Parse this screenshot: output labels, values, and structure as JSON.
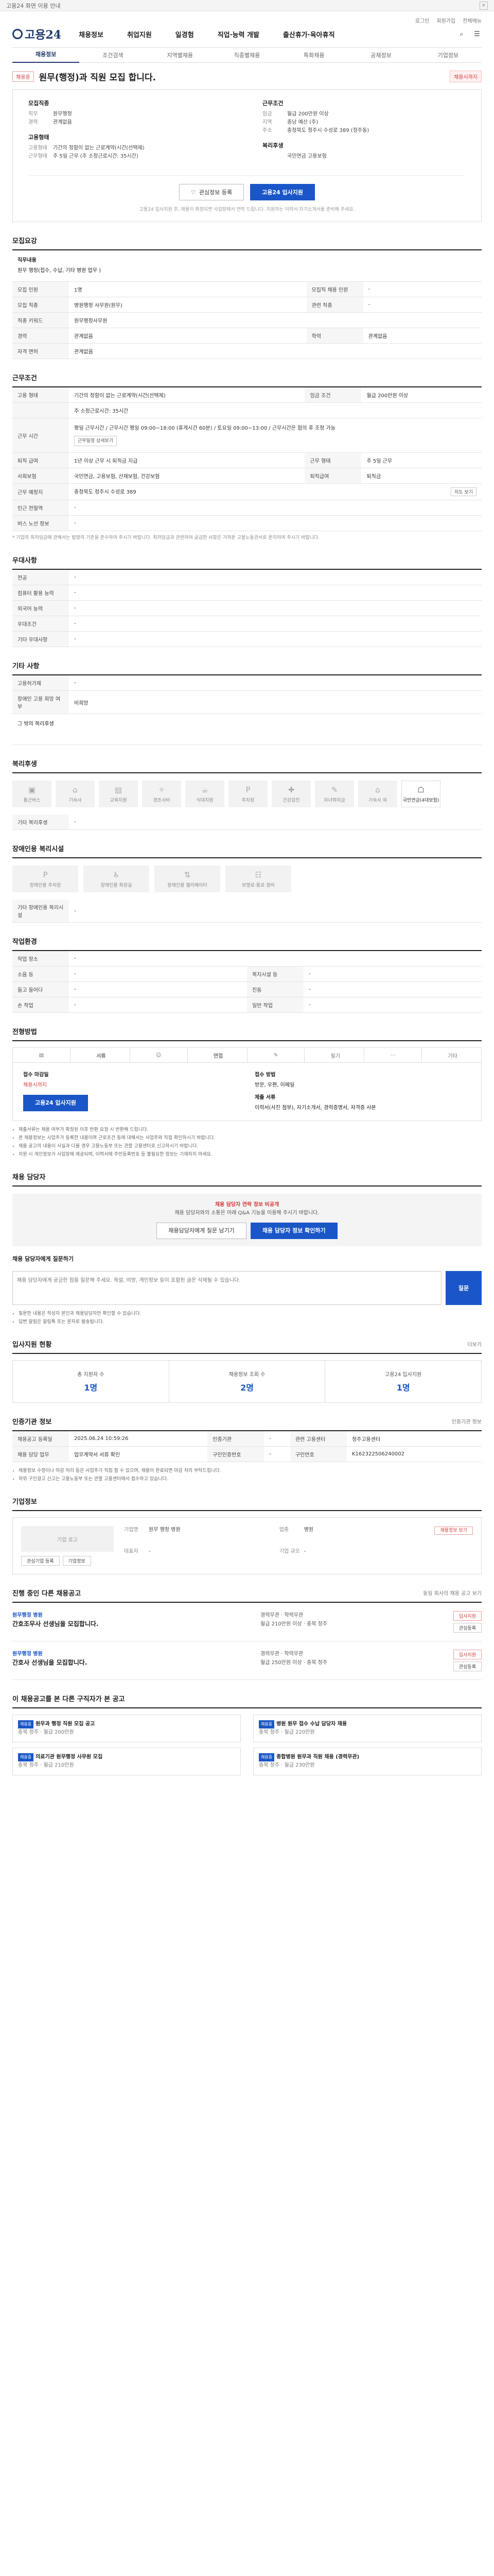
{
  "topbar": {
    "text": "고용24 화면 이용 안내",
    "close": "×"
  },
  "header": {
    "top_links": [
      "로그인",
      "회원가입",
      "전체메뉴"
    ],
    "logo": "고용24",
    "nav": [
      "채용정보",
      "취업지원",
      "일경험",
      "직업·능력 개발",
      "출산휴가·육아휴직"
    ],
    "subnav": [
      "채용정보",
      "조건검색",
      "지역별채용",
      "직종별채용",
      "특화채용",
      "공채정보",
      "기업정보"
    ]
  },
  "job": {
    "badge": "채용중",
    "title": "원무(행정)과 직원 모집 합니다.",
    "deadline": "채용시까지",
    "left_head": "모집직종",
    "left_kv": [
      {
        "k": "직무",
        "v": "원무행정"
      },
      {
        "k": "경력",
        "v": "관계없음"
      }
    ],
    "left_head2": "고용형태",
    "left_kv2": [
      {
        "k": "고용형태",
        "v": "기간의 정함이 없는 근로계약(시간(선택제)"
      },
      {
        "k": "근무형태",
        "v": "주 5일 근무 (주 소정근로시간: 35시간)"
      }
    ],
    "right_head": "근무조건",
    "right_kv": [
      {
        "k": "임금",
        "v": "월급 200만원 이상"
      },
      {
        "k": "지역",
        "v": "충남 예산 (주)"
      },
      {
        "k": "주소",
        "v": "충청북도 청주시 수성로 389 (청주동)"
      }
    ],
    "right_head2": "복리후생",
    "right_kv2": [
      {
        "k": "",
        "v": "국민연금 고용보험"
      }
    ],
    "btn_save": "관심정보 등록",
    "btn_apply": "고용24 입사지원",
    "notice": "고용24 입사지원 후, 채용이 확정되면 사업장에서 연락 드립니다. 지원자는 이력서·자기소개서를 준비해 주세요."
  },
  "recruit": {
    "title": "모집요강",
    "desc_head": "직무내용",
    "desc": "원무 행정(접수, 수납, 기타 병원 업무 )",
    "rows": [
      {
        "k1": "모집 인원",
        "v1": "1명",
        "k2": "모집직 채용 인원",
        "v2": "-"
      },
      {
        "k1": "모집 직종",
        "v1": "병원행정 사무원(원무)",
        "k2": "관련 직종",
        "v2": "-"
      },
      {
        "k1": "직종 키워드",
        "v1": "원무행정사무원"
      },
      {
        "k1": "경력",
        "v1": "관계없음",
        "k2": "학력",
        "v2": "관계없음"
      },
      {
        "k1": "자격 면허",
        "v1": "관계없음"
      }
    ]
  },
  "condition": {
    "title": "근무조건",
    "r1_k": "고용 형태",
    "r1_v": "기간의 정함이 없는 근로계약(시간(선택제)",
    "r1_k2": "임금 조건",
    "r1_v2": "월급 200만원 이상",
    "r2_v": "주 소정근로시간: 35시간",
    "r3_k": "근무 시간",
    "r3_v": "평일 근무시간 / 근무시간 평일 09:00~18:00 (휴게시간 60분) / 토요일 09:00~13:00 / 근무시간은 협의 후 조정 가능",
    "r3_btn": "근무일정 상세보기",
    "r4_k": "퇴직 급여",
    "r4_v": "1년 이상 근무 시 퇴직금 지급",
    "r4_k2": "근무 형태",
    "r4_v2": "주 5일 근무",
    "r5_k": "사회보험",
    "r5_v": "국민연금, 고용보험, 산재보험, 건강보험",
    "r5_k2": "퇴직급여",
    "r5_v2": "퇴직금",
    "r6_k": "근무 예정지",
    "r6_v": "충청북도 청주시 수성로 389",
    "r6_btn": "지도 보기",
    "r7_k": "인근 전철역",
    "r7_v": "-",
    "r8_k": "버스 노선 정보",
    "r8_v": "-",
    "note": "* 기업의 최저임금에 관해서는 법령의 기준을 준수하여 주시기 바랍니다. 최저임금과 관련하여 궁금한 사항은 가까운 고용노동관서로 문의하여 주시기 바랍니다."
  },
  "prefer": {
    "title": "우대사항",
    "rows": [
      {
        "k": "전공",
        "v": "-"
      },
      {
        "k": "컴퓨터 활용 능력",
        "v": "-"
      },
      {
        "k": "외국어 능력",
        "v": "-"
      },
      {
        "k": "우대조건",
        "v": "-"
      },
      {
        "k": "기타 우대사항",
        "v": "-"
      }
    ]
  },
  "etc": {
    "title": "기타 사항",
    "rows": [
      {
        "k": "고용허가제",
        "v": "-"
      },
      {
        "k": "장애인 고용 희망 여부",
        "v": "비희망"
      }
    ],
    "extra": "그 밖의 복리후생"
  },
  "welfare": {
    "title": "복리후생",
    "items": [
      "통근버스",
      "기숙사",
      "교육지원",
      "경조사비",
      "식대지원",
      "주차장",
      "건강검진",
      "자녀학자금",
      "기숙사 외",
      "국민연금(4대보험)"
    ],
    "extra_label": "기타 복리후생",
    "extra_value": "-"
  },
  "handicap": {
    "title": "장애인용 복리시설",
    "items": [
      "장애인용 주차장",
      "장애인용 화장실",
      "장애인용 엘리베이터",
      "보행로·통로 정비"
    ],
    "extra_label": "기타 장애인용 복리시설",
    "extra_value": "-"
  },
  "env": {
    "title": "작업환경",
    "rows": [
      {
        "k1": "작업 장소",
        "v1": "-"
      },
      {
        "k1": "소음 등",
        "v1": "-",
        "k2": "복지시설 등",
        "v2": "-"
      },
      {
        "k1": "들고 들어다",
        "v1": "-",
        "k2": "진동",
        "v2": "-"
      },
      {
        "k1": "손 작업",
        "v1": "-",
        "k2": "일반 작업",
        "v2": "-"
      }
    ]
  },
  "method": {
    "title": "전형방법",
    "tabs": [
      "서류",
      "면접",
      "필기",
      "기타"
    ],
    "col1_h": "접수 마감일",
    "col1_v": "채용시까지",
    "col1_btn": "고용24 입사지원",
    "col2_h": "접수 방법",
    "col2_v": "방문, 우편, 이메일",
    "col2_h2": "제출 서류",
    "col2_v2": "이력서(사진 첨부), 자기소개서, 경력증명서, 자격증 사본",
    "bullets": [
      "제출서류는 채용 여부가 확정된 이후 반환 요청 시 반환해 드립니다.",
      "본 채용정보는 사업주가 등록한 내용이며 근로조건 등에 대해서는 사업주와 직접 확인하시기 바랍니다.",
      "채용 공고의 내용이 사실과 다를 경우 고용노동부 또는 관할 고용센터로 신고하시기 바랍니다.",
      "지원 시 개인정보가 사업장에 제공되며, 이력서에 주민등록번호 등 불필요한 정보는 기재하지 마세요."
    ]
  },
  "consult": {
    "title": "채용 담당자",
    "h": "채용 담당자 연락 정보 비공개",
    "body": "채용 담당자와의 소통은 아래 Q&A 기능을 이용해 주시기 바랍니다.",
    "btn1": "채용담당자에게 질문 남기기",
    "btn2": "채용 담당자 정보 확인하기",
    "q_title": "채용 담당자에게 질문하기",
    "q_placeholder": "채용 담당자에게 궁금한 점을 질문해 주세요. 욕설, 비방, 개인정보 등이 포함된 글은 삭제될 수 있습니다.",
    "q_btn": "질문",
    "q_notes": [
      "질문한 내용은 작성자 본인과 채용담당자만 확인할 수 있습니다.",
      "답변 알림은 알림톡 또는 문자로 발송됩니다."
    ]
  },
  "stats": {
    "title": "입사지원 현황",
    "more": "더보기",
    "items": [
      {
        "l": "총 지원자 수",
        "v": "1명"
      },
      {
        "l": "채용정보 조회 수",
        "v": "2명"
      },
      {
        "l": "고용24 입사지원",
        "v": "1명"
      }
    ]
  },
  "agency": {
    "title": "인증기관 정보",
    "btn": "인증기관 정보",
    "rows": [
      {
        "k1": "채용공고 등록일",
        "v1": "2025.06.24 10:59:26",
        "k2": "인증기관",
        "v2": "-",
        "k3": "관련 고용센터",
        "v3": "청주고용센터"
      },
      {
        "k1": "채용 담당 업무",
        "v1": "업무계약서 서류 확인",
        "k2": "구인인증번호",
        "v2": "-",
        "k3": "구인번호",
        "v3": "K162322506240002"
      }
    ],
    "notes": [
      "채용정보 수정이나 마감 처리 등은 사업주가 직접 할 수 있으며, 채용이 완료되면 마감 처리 부탁드립니다.",
      "허위 구인광고 신고는 고용노동부 또는 관할 고용센터에서 접수하고 있습니다."
    ]
  },
  "company": {
    "title": "기업정보",
    "logo": "기업 로고",
    "rows": [
      {
        "k": "기업명",
        "v": "원무 행정 병원"
      },
      {
        "k": "업종",
        "v": "병원"
      },
      {
        "k": "대표자",
        "v": "-"
      },
      {
        "k": "기업 규모",
        "v": "-"
      }
    ],
    "btn1": "관심기업 등록",
    "btn2": "기업정보",
    "btn3": "채용정보 보기"
  },
  "others": {
    "title": "진행 중인 다른 채용공고",
    "more": "동일 회사의 채용 공고 보기",
    "items": [
      {
        "co": "원무행정 병원",
        "t": "간호조무사 선생님을 모집합니다.",
        "m1": "경력무관 · 학력무관",
        "m2": "월급 210만원 이상 · 충북 청주",
        "btn1": "입사지원",
        "btn2": "관심등록"
      },
      {
        "co": "원무행정 병원",
        "t": "간호사 선생님을 모집합니다.",
        "m1": "경력무관 · 학력무관",
        "m2": "월급 250만원 이상 · 충북 청주",
        "btn1": "입사지원",
        "btn2": "관심등록"
      }
    ]
  },
  "recommend": {
    "title": "이 채용공고를 본 다른 구직자가 본 공고",
    "items": [
      {
        "tag": "채용중",
        "t": "원무과 행정 직원 모집 공고",
        "m": "충북 청주 · 월급 200만원"
      },
      {
        "tag": "채용중",
        "t": "병원 원무 접수 수납 담당자 채용",
        "m": "충북 청주 · 월급 220만원"
      },
      {
        "tag": "채용중",
        "t": "의료기관 원무행정 사무원 모집",
        "m": "충북 청주 · 월급 210만원"
      },
      {
        "tag": "채용중",
        "t": "종합병원 원무과 직원 채용 (경력무관)",
        "m": "충북 청주 · 월급 230만원"
      }
    ]
  }
}
